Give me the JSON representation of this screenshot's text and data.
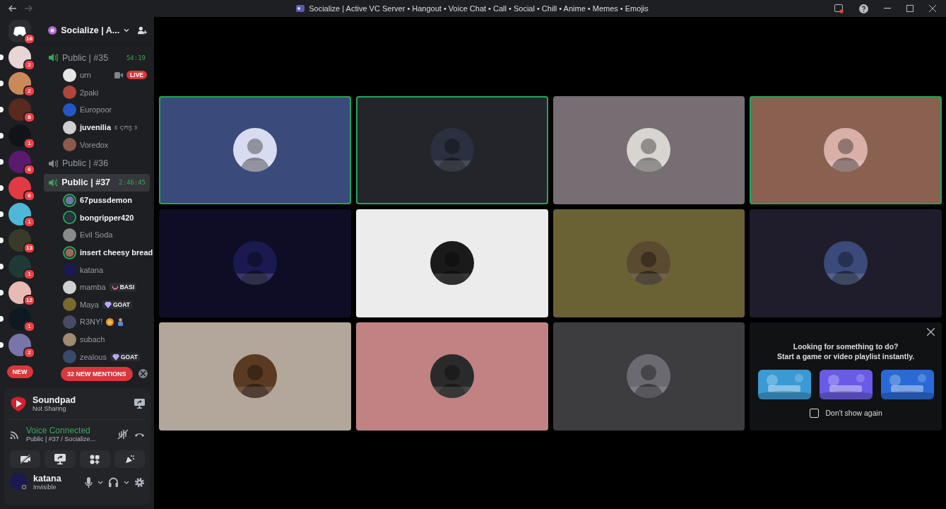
{
  "window": {
    "title": "Socialize | Active VC Server • Hangout • Voice Chat • Call • Social • Chill • Anime • Memes • Emojis"
  },
  "servers": [
    {
      "badge": "16",
      "color": "#2b2d31",
      "unread": false
    },
    {
      "badge": "2",
      "color": "#e8d6d6",
      "unread": true
    },
    {
      "badge": "2",
      "color": "#c98a5a",
      "unread": true
    },
    {
      "badge": "8",
      "color": "#5a2a1e",
      "unread": true
    },
    {
      "badge": "1",
      "color": "#101418",
      "unread": true
    },
    {
      "badge": "6",
      "color": "#5c1a6e",
      "unread": true
    },
    {
      "badge": "6",
      "color": "#e23a44",
      "unread": true
    },
    {
      "badge": "1",
      "color": "#4fb8d6",
      "unread": true
    },
    {
      "badge": "13",
      "color": "#3a3a2a",
      "unread": true
    },
    {
      "badge": "1",
      "color": "#1f3a36",
      "unread": true
    },
    {
      "badge": "12",
      "color": "#e9b9b4",
      "unread": true
    },
    {
      "badge": "1",
      "color": "#0e1a22",
      "unread": true
    },
    {
      "badge": "2",
      "color": "#7a74a8",
      "unread": true
    }
  ],
  "new_pill": "NEW",
  "server_header": {
    "name": "Socialize | A..."
  },
  "channels": [
    {
      "name": "Public | #35",
      "active": true,
      "selected": false,
      "timer": "54:19",
      "users": [
        {
          "name": "urn",
          "speaking": false,
          "bright": false,
          "live": "LIVE",
          "color": "#e6e6e6"
        },
        {
          "name": "2paki",
          "speaking": false,
          "bright": false,
          "color": "#b0453c"
        },
        {
          "name": "Europoor",
          "speaking": false,
          "bright": false,
          "color": "#2456c8"
        },
        {
          "name": "juvenilia",
          "extra": "ɛ ςოჳ ɜ",
          "speaking": false,
          "bright": true,
          "color": "#cfcfcf"
        },
        {
          "name": "Voredox",
          "speaking": false,
          "bright": false,
          "color": "#8a5a4a"
        }
      ]
    },
    {
      "name": "Public | #36",
      "active": false,
      "selected": false
    },
    {
      "name": "Public | #37",
      "active": true,
      "selected": true,
      "timer": "2:46:45",
      "users": [
        {
          "name": "67pussdemon",
          "speaking": true,
          "bright": true,
          "color": "#6a7aa0"
        },
        {
          "name": "bongripper420",
          "speaking": true,
          "bright": true,
          "color": "#2a3448"
        },
        {
          "name": "Evil Soda",
          "speaking": false,
          "bright": false,
          "color": "#8a8a8a"
        },
        {
          "name": "insert cheesy bread",
          "speaking": true,
          "bright": true,
          "color": "#9a6a5a"
        },
        {
          "name": "katana",
          "speaking": false,
          "bright": false,
          "color": "#1a1a50"
        },
        {
          "name": "mamba",
          "speaking": false,
          "bright": false,
          "color": "#d0d0d0",
          "tag": {
            "kind": "crescent",
            "text": "BASI"
          }
        },
        {
          "name": "Maya",
          "speaking": false,
          "bright": false,
          "color": "#7a6a30",
          "tag": {
            "kind": "diamond",
            "text": "GOAT"
          }
        },
        {
          "name": "R3NY!",
          "speaking": false,
          "bright": false,
          "color": "#4a4a66",
          "emojis": true
        },
        {
          "name": "subach",
          "speaking": false,
          "bright": false,
          "color": "#a08a70"
        },
        {
          "name": "zealous",
          "speaking": false,
          "bright": false,
          "color": "#3a4a6a",
          "tag": {
            "kind": "diamond",
            "text": "GOAT"
          }
        }
      ]
    }
  ],
  "mentions_pill": "32 NEW MENTIONS",
  "soundpad": {
    "title": "Soundpad",
    "status": "Not Sharing"
  },
  "voice": {
    "status": "Voice Connected",
    "channel": "Public | #37 / Socialize..."
  },
  "account": {
    "name": "katana",
    "status": "Invisible"
  },
  "tiles": [
    {
      "color": "#3a4a7a",
      "speaking": true
    },
    {
      "color": "#23252b",
      "speaking": true
    },
    {
      "color": "#766e72",
      "speaking": false
    },
    {
      "color": "#8a6050",
      "speaking": true
    },
    {
      "color": "#0f0d26",
      "speaking": false
    },
    {
      "color": "#ececec",
      "speaking": false
    },
    {
      "color": "#6a6234",
      "speaking": false
    },
    {
      "color": "#1f1d2b",
      "speaking": false
    },
    {
      "color": "#b3a69a",
      "speaking": false
    },
    {
      "color": "#c08282",
      "speaking": false
    },
    {
      "color": "#3d3d40",
      "speaking": false
    }
  ],
  "activity": {
    "heading": "Looking for something to do?",
    "subheading": "Start a game or video playlist instantly.",
    "thumbs": [
      {
        "color": "#3a9ad6"
      },
      {
        "color": "#6a5ae8"
      },
      {
        "color": "#2a6ad8"
      }
    ],
    "dont_show": {
      "label": "Don't show again",
      "checked": false
    }
  }
}
